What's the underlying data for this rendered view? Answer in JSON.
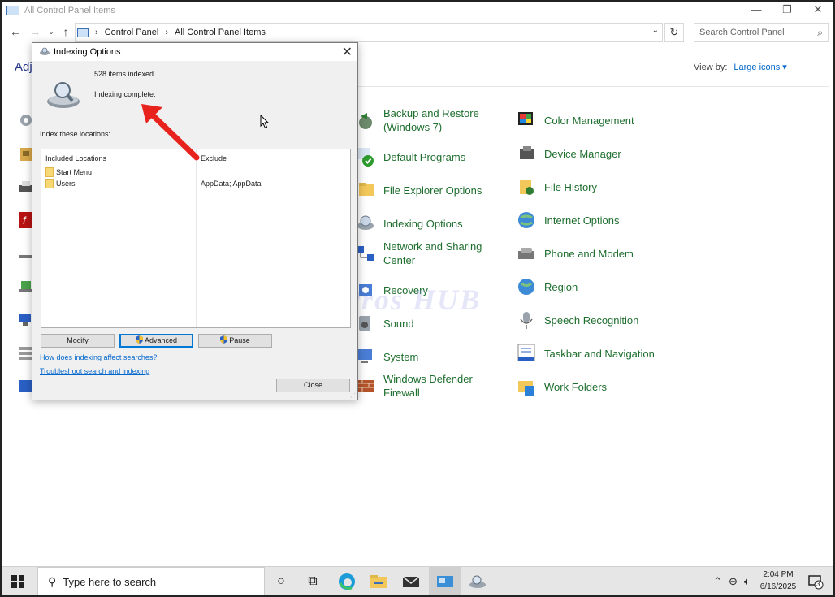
{
  "window": {
    "title": "All Control Panel Items",
    "controls": {
      "minimize": "—",
      "restore": "❐",
      "close": "✕"
    }
  },
  "address": {
    "crumbs": [
      "Control Panel",
      "All Control Panel Items"
    ],
    "search_placeholder": "Search Control Panel"
  },
  "header": {
    "adjust_fragment": "Adj",
    "view_by_label": "View by:",
    "view_by_value": "Large icons ▾"
  },
  "items": {
    "backup": "Backup and Restore",
    "backup2": "(Windows 7)",
    "color": "Color Management",
    "defaults": "Default Programs",
    "devmgr": "Device Manager",
    "fileexp": "File Explorer Options",
    "filehist": "File History",
    "indexing": "Indexing Options",
    "internet": "Internet Options",
    "network": "Network and Sharing",
    "network2": "Center",
    "phone": "Phone and Modem",
    "recovery": "Recovery",
    "region": "Region",
    "sound": "Sound",
    "speech": "Speech Recognition",
    "system": "System",
    "taskbar": "Taskbar and Navigation",
    "defender": "Windows Defender",
    "defender2": "Firewall",
    "workfolders": "Work Folders"
  },
  "watermark": "IT Pros HUB",
  "dialog": {
    "title": "Indexing Options",
    "items_indexed": "528 items indexed",
    "status": "Indexing complete.",
    "index_label": "Index these locations:",
    "col_included": "Included Locations",
    "col_exclude": "Exclude",
    "locations": [
      "Start Menu",
      "Users"
    ],
    "users_exclude": "AppData; AppData",
    "buttons": {
      "modify": "Modify",
      "advanced": "Advanced",
      "pause": "Pause",
      "close": "Close"
    },
    "links": {
      "how": "How does indexing affect searches?",
      "troubleshoot": "Troubleshoot search and indexing"
    }
  },
  "taskbar": {
    "search_placeholder": "Type here to search",
    "time": "2:04 PM",
    "date": "6/16/2025",
    "notifications": "3"
  },
  "colors": {
    "item_text": "#1e6e2e",
    "link": "#0066cc",
    "arrow": "#e8231e"
  }
}
